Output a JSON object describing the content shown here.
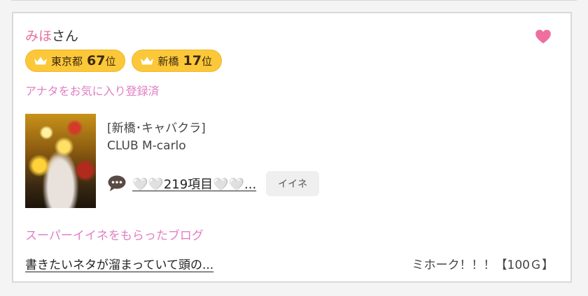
{
  "user": {
    "name": "みほ",
    "suffix": "さん"
  },
  "rankings": [
    {
      "area": "東京都",
      "rank": "67",
      "unit": "位"
    },
    {
      "area": "新橋",
      "rank": "17",
      "unit": "位"
    }
  ],
  "favorite_status": "アナタをお気に入り登録済",
  "shop": {
    "category": "[新橋･キャバクラ]",
    "name": "CLUB M-carlo"
  },
  "comment": {
    "text": "🤍🤍219項目🤍🤍...",
    "iine_label": "イイネ"
  },
  "super_iine_heading": "スーパーイイネをもらったブログ",
  "blog": {
    "title": "書きたいネタが溜まっていて頭の...",
    "meta": "ミホーク！！！【100Ｇ】"
  },
  "colors": {
    "accent_pink": "#e07fc4",
    "name_pink": "#e8709e",
    "heart_pink": "#ee6f9e",
    "badge_yellow": "#fcc83a"
  },
  "icons": {
    "favorite": "heart-icon",
    "rank": "crown-icon",
    "comment": "speech-bubble-icon"
  }
}
